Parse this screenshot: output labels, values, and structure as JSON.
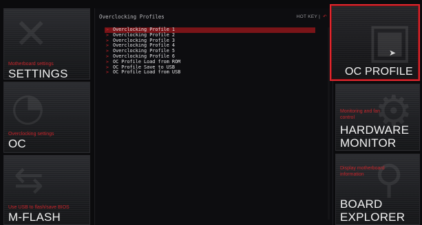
{
  "left_tiles": [
    {
      "subtitle": "Motherboard settings",
      "title": "SETTINGS",
      "icon": "wrench-screwdriver-icon"
    },
    {
      "subtitle": "Overclocking settings",
      "title": "OC",
      "icon": "speedometer-icon"
    },
    {
      "subtitle": "Use USB to flash/save BIOS",
      "title": "M-FLASH",
      "icon": "usb-icon"
    }
  ],
  "right_tiles": [
    {
      "subtitle": "",
      "title": "OC PROFILE",
      "icon": "chip-icon",
      "selected": true
    },
    {
      "subtitle": "Monitoring and fan control",
      "title_line1": "HARDWARE",
      "title_line2": "MONITOR",
      "icon": "gear-icon"
    },
    {
      "subtitle": "Display motherboard information",
      "title_line1": "BOARD",
      "title_line2": "EXPLORER",
      "icon": "magnifier-icon"
    }
  ],
  "panel": {
    "title": "Overclocking Profiles",
    "hotkey_label": "HOT KEY",
    "hotkey_sep": "|",
    "undo_symbol": "↶",
    "items": [
      "Overclocking Profile 1",
      "Overclocking Profile 2",
      "Overclocking Profile 3",
      "Overclocking Profile 4",
      "Overclocking Profile 5",
      "Overclocking Profile 6",
      "OC Profile Load from ROM",
      "OC Profile Save to USB",
      "OC Profile Load from USB"
    ],
    "active_index": 0
  },
  "colors": {
    "accent": "#e0272e",
    "subtitle_red": "#c8262c",
    "background": "#0b0b0d"
  }
}
